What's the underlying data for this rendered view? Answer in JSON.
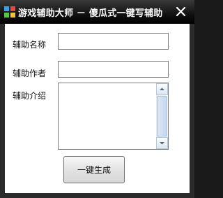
{
  "window": {
    "title": "游戏辅助大师 － 傻瓜式一键写辅助",
    "icon": "app-icon",
    "close_icon": "close-icon"
  },
  "form": {
    "name_label": "辅助名称",
    "name_value": "",
    "author_label": "辅助作者",
    "author_value": "",
    "intro_label": "辅助介绍",
    "intro_value": "",
    "generate_button_label": "一键生成"
  },
  "colors": {
    "titlebar": "#000000",
    "window_frame": "#2b2b2b",
    "client_background": "#ffffff",
    "scrollbar_accent": "#c4d8ef"
  }
}
